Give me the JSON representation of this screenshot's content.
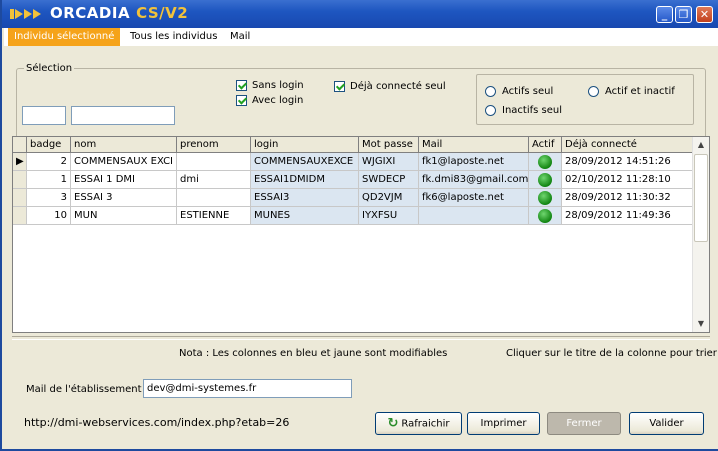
{
  "window": {
    "title": "ORCADIA",
    "version": "CS/V2"
  },
  "menu": [
    "Individu sélectionné",
    "Tous les individus",
    "Mail"
  ],
  "selection": {
    "title": "Sélection",
    "checkboxes": {
      "sans_login": "Sans login",
      "avec_login": "Avec login",
      "deja_connecte": "Déjà connecté seul"
    },
    "radios": {
      "actifs": "Actifs seul",
      "inactifs": "Inactifs seul",
      "actif_inactif": "Actif et inactif"
    }
  },
  "table": {
    "headers": [
      "badge",
      "nom",
      "prenom",
      "login",
      "Mot passe",
      "Mail",
      "Actif",
      "Déjà connecté"
    ],
    "rows": [
      {
        "badge": "2",
        "nom": "COMMENSAUX EXCI",
        "prenom": "",
        "login": "COMMENSAUXEXCE",
        "mdp": "WJGIXI",
        "mail": "fk1@laposte.net",
        "actif": "green",
        "connecte": "28/09/2012 14:51:26"
      },
      {
        "badge": "1",
        "nom": "ESSAI 1 DMI",
        "prenom": "dmi",
        "login": "ESSAI1DMIDM",
        "mdp": "SWDECP",
        "mail": "fk.dmi83@gmail.com",
        "actif": "green",
        "connecte": "02/10/2012 11:28:10"
      },
      {
        "badge": "3",
        "nom": "ESSAI 3",
        "prenom": "",
        "login": "ESSAI3",
        "mdp": "QD2VJM",
        "mail": "fk6@laposte.net",
        "actif": "green",
        "connecte": "28/09/2012 11:30:32"
      },
      {
        "badge": "10",
        "nom": "MUN",
        "prenom": "ESTIENNE",
        "login": "MUNES",
        "mdp": "IYXFSU",
        "mail": "",
        "actif": "green",
        "connecte": "28/09/2012 11:49:36"
      }
    ]
  },
  "notes": {
    "modifiable": "Nota : Les colonnes en bleu et jaune sont modifiables",
    "sort": "Cliquer sur le titre de la colonne pour trier"
  },
  "etablissement": {
    "label": "Mail de l'établissement",
    "value": "dev@dmi-systemes.fr"
  },
  "url": "http://dmi-webservices.com/index.php?etab=26",
  "buttons": {
    "refresh": "Rafraichir",
    "print": "Imprimer",
    "close": "Fermer",
    "validate": "Valider"
  },
  "colors": {
    "title_bar": "#1e56c0",
    "menu_active": "#f5a31a",
    "editable_cell": "#dbe6f1",
    "active_dot": "#1a9a1a"
  }
}
